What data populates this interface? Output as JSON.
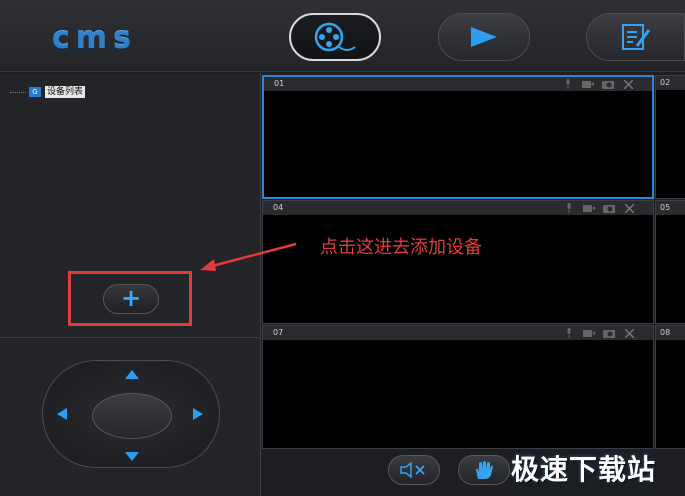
{
  "app": {
    "logo_text": "cms"
  },
  "toolbar": {
    "buttons": [
      {
        "name": "video-reel",
        "icon": "film-reel-icon",
        "active": true
      },
      {
        "name": "playback",
        "icon": "play-icon",
        "active": false
      },
      {
        "name": "edit-log",
        "icon": "notepad-pen-icon",
        "active": false
      }
    ]
  },
  "device_tree": {
    "badge": "G",
    "root_label": "设备列表"
  },
  "add_device": {
    "label": "+"
  },
  "annotation": {
    "text": "点击这进去添加设备"
  },
  "grid": {
    "cells": [
      {
        "num": "01",
        "selected": true
      },
      {
        "num": "02"
      },
      {
        "num": "04"
      },
      {
        "num": "05"
      },
      {
        "num": "07"
      },
      {
        "num": "08"
      }
    ]
  },
  "watermark": {
    "text": "极速下载站"
  },
  "colors": {
    "accent": "#2e86d8",
    "annotation_red": "#e23b3b",
    "background": "#1d1e21"
  }
}
